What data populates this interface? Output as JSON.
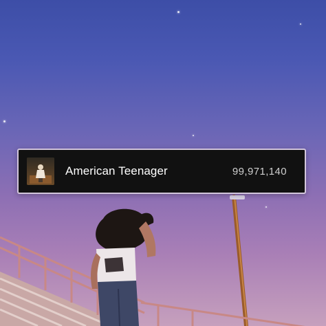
{
  "track": {
    "title": "American Teenager",
    "play_count": "99,971,140",
    "album_art_icon": "album-cover-image"
  },
  "colors": {
    "card_background": "#111111",
    "card_border": "#d3c6dc",
    "title_text": "#ffffff",
    "count_text": "#cfcfcf",
    "sky_top": "#3d4ea7",
    "sky_bottom": "#c6a0bd"
  }
}
